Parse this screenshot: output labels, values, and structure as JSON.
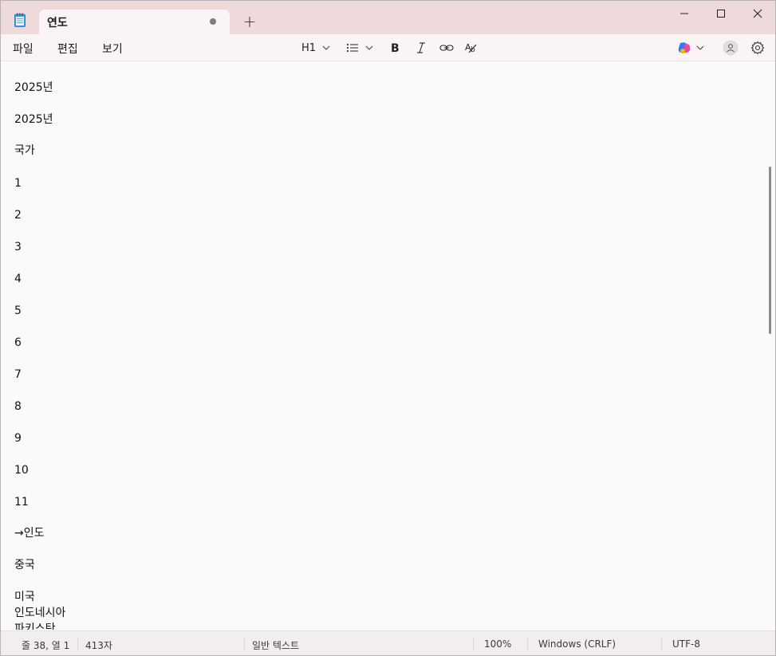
{
  "tab": {
    "title": "연도"
  },
  "menu": {
    "file": "파일",
    "edit": "편집",
    "view": "보기"
  },
  "toolbar": {
    "heading_label": "H1"
  },
  "editor": {
    "lines": [
      "2025년",
      "2025년",
      "국가",
      "1",
      "2",
      "3",
      "4",
      "5",
      "6",
      "7",
      "8",
      "9",
      "10",
      "11",
      "→인도",
      "중국",
      "미국",
      "인도네시아",
      "파키스탄"
    ]
  },
  "status": {
    "position": "줄 38, 열 1",
    "chars": "413자",
    "format": "일반 텍스트",
    "zoom": "100%",
    "line_ending": "Windows (CRLF)",
    "encoding": "UTF-8"
  },
  "colors": {
    "titlebar": "#eed9db",
    "tab": "#faf4f4",
    "copilot_blue": "#2f7bf5",
    "copilot_pink": "#e9489b",
    "copilot_yellow": "#f4b400"
  }
}
